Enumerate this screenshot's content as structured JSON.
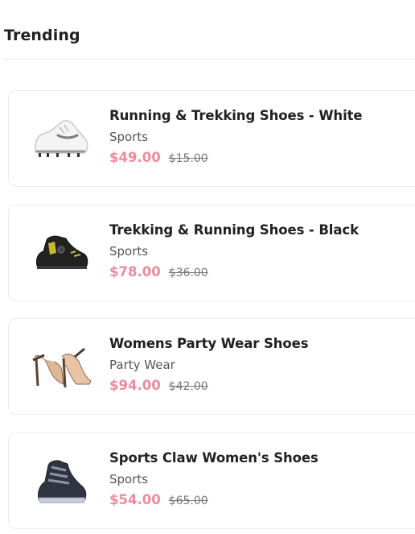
{
  "section": {
    "title": "Trending"
  },
  "products": [
    {
      "name": "Running & Trekking Shoes - White",
      "category": "Sports",
      "price": "$49.00",
      "old_price": "$15.00",
      "icon": "white-sneaker-icon"
    },
    {
      "name": "Trekking & Running Shoes - Black",
      "category": "Sports",
      "price": "$78.00",
      "old_price": "$36.00",
      "icon": "black-boot-icon"
    },
    {
      "name": "Womens Party Wear Shoes",
      "category": "Party Wear",
      "price": "$94.00",
      "old_price": "$42.00",
      "icon": "high-heel-icon"
    },
    {
      "name": "Sports Claw Women's Shoes",
      "category": "Sports",
      "price": "$54.00",
      "old_price": "$65.00",
      "icon": "high-top-sneaker-icon"
    }
  ],
  "colors": {
    "price": "#f08a9b",
    "text": "#212121",
    "muted": "#555555",
    "border": "#ebebeb"
  }
}
